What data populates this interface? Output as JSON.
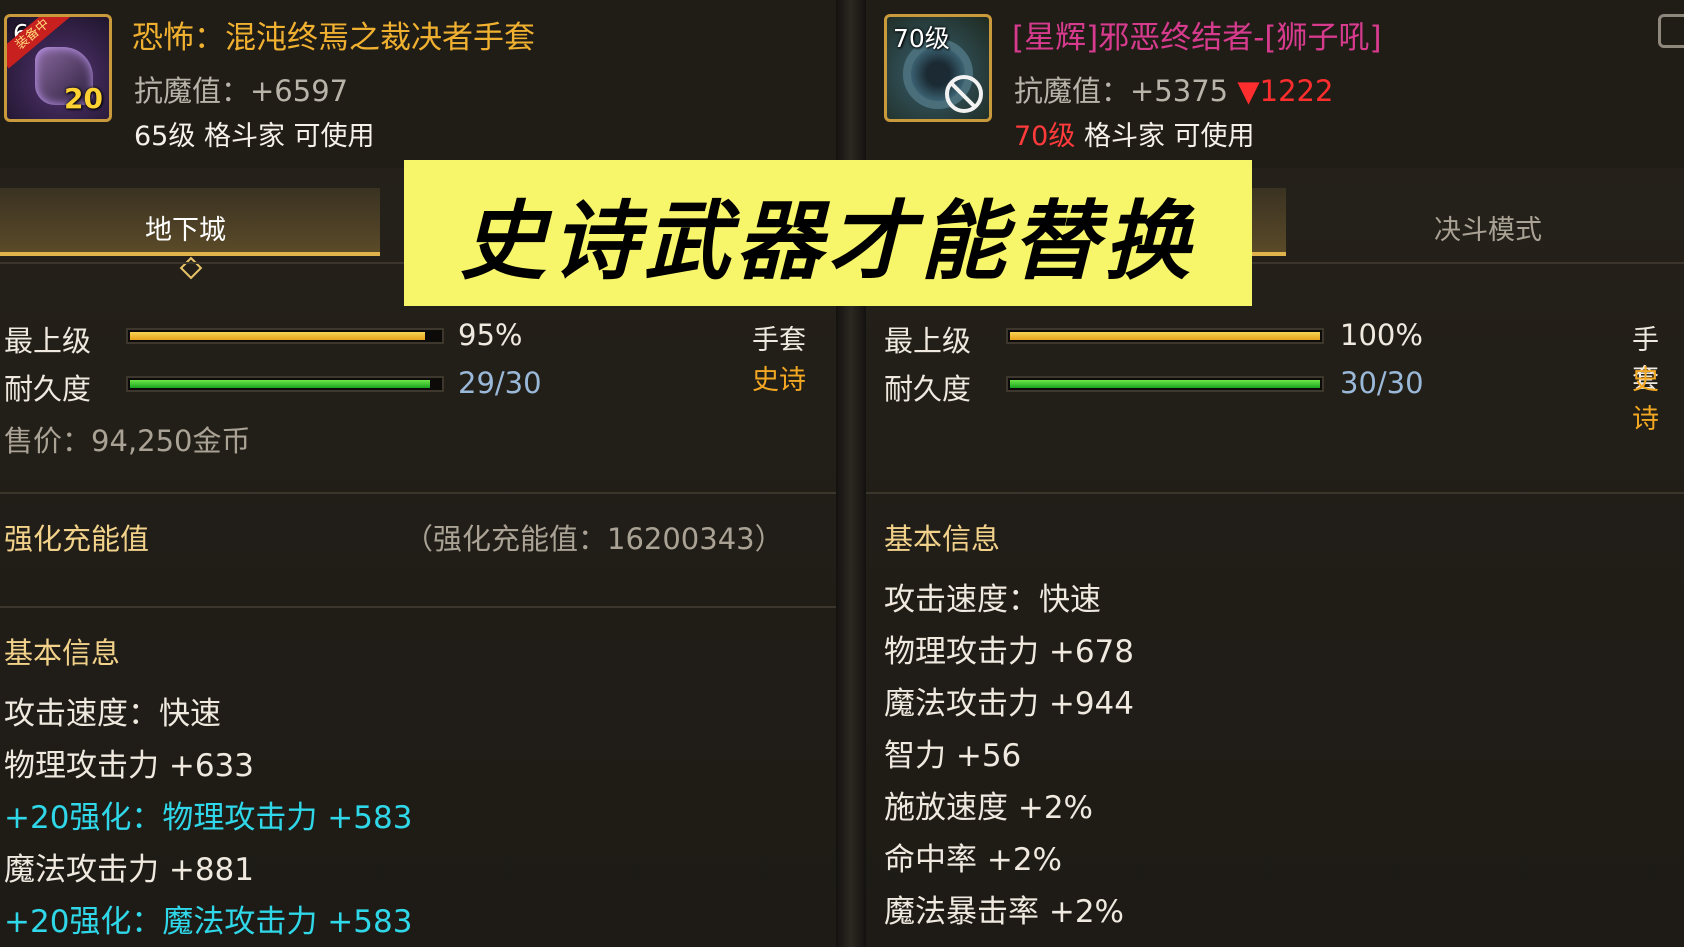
{
  "left_item": {
    "level_badge": "6",
    "ribbon": "装备中",
    "stack_count": "20",
    "name": "恐怖：混沌终焉之裁决者手套",
    "resist": "抗魔值：+6597",
    "requirement": "65级 格斗家 可使用",
    "tab_active": "地下城",
    "bars": {
      "grade_label": "最上级",
      "grade_value": "95%",
      "grade_fraction": 0.95,
      "durability_label": "耐久度",
      "durability_value": "29/30",
      "durability_fraction": 0.9667
    },
    "slot": "手套",
    "rarity": "史诗",
    "price": "售价：94,250金币",
    "charge_title": "强化充能值",
    "charge_info": "（强化充能值：16200343）",
    "basic_title": "基本信息",
    "stats": [
      "攻击速度：快速",
      "物理攻击力 +633",
      "+20强化：物理攻击力 +583",
      "魔法攻击力 +881",
      "+20强化：魔法攻击力 +583"
    ]
  },
  "right_item": {
    "level_badge": "70级",
    "name": "[星辉]邪恶终结者-[狮子吼]",
    "resist": "抗魔值：+5375",
    "resist_diff": "▼1222",
    "req_level": "70级",
    "req_rest": " 格斗家 可使用",
    "tab_inactive": "决斗模式",
    "bars": {
      "grade_label": "最上级",
      "grade_value": "100%",
      "grade_fraction": 1.0,
      "durability_label": "耐久度",
      "durability_value": "30/30",
      "durability_fraction": 1.0
    },
    "slot": "手套",
    "rarity": "史诗",
    "basic_title": "基本信息",
    "stats": [
      "攻击速度：快速",
      "物理攻击力 +678",
      "魔法攻击力 +944",
      "智力 +56",
      "施放速度 +2%",
      "命中率 +2%",
      "魔法暴击率 +2%"
    ]
  },
  "banner": {
    "text": "史诗武器才能替换"
  },
  "colors": {
    "item_name_left": "#f0b030",
    "item_name_right": "#d63b8e",
    "enhance_text": "#2fd7e8",
    "rarity": "#f2a822",
    "banner_bg": "#f7f56a"
  },
  "icons": [
    "gauntlet-item-icon",
    "gun-item-icon",
    "unusable-icon",
    "compare-icon",
    "tab-diamond-icon"
  ]
}
